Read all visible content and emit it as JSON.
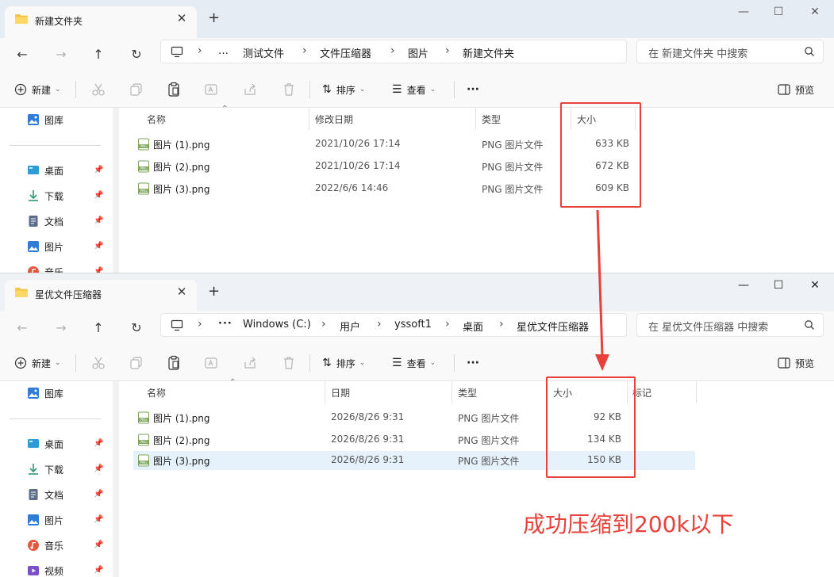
{
  "window1": {
    "tab_title": "新建文件夹",
    "breadcrumbs": [
      "…",
      "测试文件",
      "文件压缩器",
      "图片",
      "新建文件夹"
    ],
    "search_placeholder": "在 新建文件夹 中搜索",
    "toolbar": {
      "new_label": "新建",
      "sort_label": "排序",
      "view_label": "查看",
      "more_label": "···",
      "preview_label": "预览"
    },
    "sidebar": [
      {
        "label": "图库",
        "icon": "gallery-icon"
      },
      {
        "label": "桌面",
        "icon": "desktop-icon",
        "pinned": true
      },
      {
        "label": "下载",
        "icon": "download-icon",
        "pinned": true
      },
      {
        "label": "文档",
        "icon": "document-icon",
        "pinned": true
      },
      {
        "label": "图片",
        "icon": "pictures-icon",
        "pinned": true
      },
      {
        "label": "音乐",
        "icon": "music-icon",
        "pinned": true
      }
    ],
    "columns": {
      "name": "名称",
      "date": "修改日期",
      "type": "类型",
      "size": "大小"
    },
    "files": [
      {
        "name": "图片 (1).png",
        "date": "2021/10/26 17:14",
        "type": "PNG 图片文件",
        "size": "633 KB"
      },
      {
        "name": "图片 (2).png",
        "date": "2021/10/26 17:14",
        "type": "PNG 图片文件",
        "size": "672 KB"
      },
      {
        "name": "图片 (3).png",
        "date": "2022/6/6 14:46",
        "type": "PNG 图片文件",
        "size": "609 KB"
      }
    ]
  },
  "window2": {
    "tab_title": "星优文件压缩器",
    "breadcrumbs": [
      "Windows (C:)",
      "用户",
      "yssoft1",
      "桌面",
      "星优文件压缩器"
    ],
    "search_placeholder": "在 星优文件压缩器 中搜索",
    "toolbar": {
      "new_label": "新建",
      "sort_label": "排序",
      "view_label": "查看",
      "more_label": "···",
      "preview_label": "预览"
    },
    "sidebar": [
      {
        "label": "图库",
        "icon": "gallery-icon"
      },
      {
        "label": "桌面",
        "icon": "desktop-icon",
        "pinned": true
      },
      {
        "label": "下载",
        "icon": "download-icon",
        "pinned": true
      },
      {
        "label": "文档",
        "icon": "document-icon",
        "pinned": true
      },
      {
        "label": "图片",
        "icon": "pictures-icon",
        "pinned": true
      },
      {
        "label": "音乐",
        "icon": "music-icon",
        "pinned": true
      },
      {
        "label": "视频",
        "icon": "video-icon",
        "pinned": true
      }
    ],
    "columns": {
      "name": "名称",
      "date": "日期",
      "type": "类型",
      "size": "大小",
      "tags": "标记"
    },
    "files": [
      {
        "name": "图片 (1).png",
        "date": "2026/8/26 9:31",
        "type": "PNG 图片文件",
        "size": "92 KB"
      },
      {
        "name": "图片 (2).png",
        "date": "2026/8/26 9:31",
        "type": "PNG 图片文件",
        "size": "134 KB"
      },
      {
        "name": "图片 (3).png",
        "date": "2026/8/26 9:31",
        "type": "PNG 图片文件",
        "size": "150 KB",
        "selected": true
      }
    ]
  },
  "annotation": {
    "caption": "成功压缩到200k以下",
    "color": "#e8413b"
  },
  "colors": {
    "accent": "#0067c0",
    "selection": "#e5f1fb",
    "titlebar": "#e6ecf3"
  }
}
